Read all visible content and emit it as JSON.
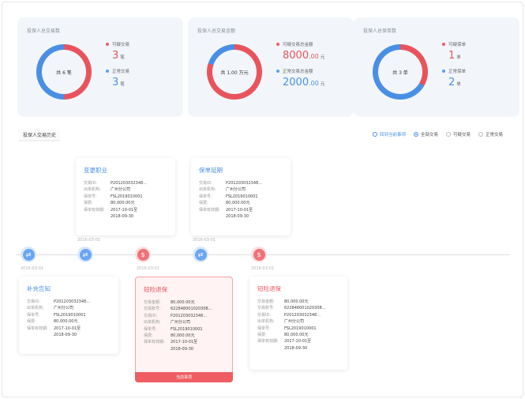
{
  "cards": [
    {
      "title": "投保人总交易数",
      "center": "共 6 笔",
      "legend": [
        {
          "label": "可疑交易",
          "value": "3",
          "unit": "笔",
          "color": "#e9545c"
        },
        {
          "label": "正常交易",
          "value": "3",
          "unit": "笔",
          "color": "#4a8fe6"
        }
      ],
      "suspicious_fraction": 0.5
    },
    {
      "title": "投保人总交易金额",
      "center": "共 1.00 万元",
      "legend": [
        {
          "label": "可疑交易总金额",
          "value": "8000",
          "decimal": ".00",
          "unit": "元",
          "color": "#e9545c"
        },
        {
          "label": "正常交易总金额",
          "value": "2000",
          "decimal": ".00",
          "unit": "元",
          "color": "#4a8fe6"
        }
      ],
      "suspicious_fraction": 0.8
    },
    {
      "title": "投保人总保单数",
      "center": "共 3 单",
      "legend": [
        {
          "label": "可疑保单",
          "value": "1",
          "unit": "单",
          "color": "#e9545c"
        },
        {
          "label": "正常保单",
          "value": "2",
          "unit": "单",
          "color": "#4a8fe6"
        }
      ],
      "suspicious_fraction": 0.333
    }
  ],
  "history": {
    "title": "投保人交易历史",
    "filters": [
      {
        "label": "回到当前事项",
        "state": "link"
      },
      {
        "label": "全部交易",
        "state": "checked"
      },
      {
        "label": "可疑交易",
        "state": "unchecked"
      },
      {
        "label": "正常交易",
        "state": "unchecked"
      }
    ]
  },
  "timeline": {
    "dates": [
      "2016-03-01",
      "2016-03-01",
      "2016-03-01",
      "2016-03-01",
      "2016-03-01"
    ],
    "nodes": [
      {
        "type": "blue",
        "icon": "transfer-icon"
      },
      {
        "type": "blue",
        "icon": "transfer-icon"
      },
      {
        "type": "red",
        "icon": "money-icon"
      },
      {
        "type": "blue",
        "icon": "transfer-icon"
      },
      {
        "type": "red",
        "icon": "money-icon"
      }
    ]
  },
  "events": {
    "top1": {
      "title": "变更职业",
      "rows": [
        {
          "k": "交易ID:",
          "v": "P201203032348..."
        },
        {
          "k": "出单机构:",
          "v": "广州分公司"
        },
        {
          "k": "保单号:",
          "v": "FSL2019010001"
        },
        {
          "k": "保费:",
          "v": "80,000.00元"
        },
        {
          "k": "保单有效期:",
          "v": "2017-10-01至\n2018-09-30"
        }
      ]
    },
    "top2": {
      "title": "保单延期",
      "rows": [
        {
          "k": "交易ID:",
          "v": "P201203032348..."
        },
        {
          "k": "出单机构:",
          "v": "广州分公司"
        },
        {
          "k": "保单号:",
          "v": "FSL2019010001"
        },
        {
          "k": "保费:",
          "v": "80,000.00元"
        },
        {
          "k": "保单有效期:",
          "v": "2017-10-01至\n2018-09-30"
        }
      ]
    },
    "bottom1": {
      "title": "补充告知",
      "rows": [
        {
          "k": "交易ID:",
          "v": "P201203032348..."
        },
        {
          "k": "出单机构:",
          "v": "广州分公司"
        },
        {
          "k": "保单号:",
          "v": "FSL2019010001"
        },
        {
          "k": "保费:",
          "v": "80,000.00元"
        },
        {
          "k": "保单有效期:",
          "v": "2017-10-01至\n2018-09-30"
        }
      ]
    },
    "bottom2": {
      "title": "短险退保",
      "rows": [
        {
          "k": "交易金额:",
          "v": "80,000.00元"
        },
        {
          "k": "交易账号:",
          "v": "622848001020308..."
        },
        {
          "k": "交易ID:",
          "v": "P201203032348..."
        },
        {
          "k": "出单机构:",
          "v": "广州分公司"
        },
        {
          "k": "保单号:",
          "v": "FSL2019010001"
        },
        {
          "k": "保费:",
          "v": "80,000.00元"
        },
        {
          "k": "保单有效期:",
          "v": "2017-10-01至\n2018-09-30"
        }
      ],
      "button": "当前事项"
    },
    "bottom3": {
      "title": "短险退保",
      "rows": [
        {
          "k": "交易金额:",
          "v": "80,000.00元"
        },
        {
          "k": "交易账号:",
          "v": "622848001020308..."
        },
        {
          "k": "交易ID:",
          "v": "P201203032348..."
        },
        {
          "k": "出单机构:",
          "v": "广州分公司"
        },
        {
          "k": "保单号:",
          "v": "FSL2019010001"
        },
        {
          "k": "保费:",
          "v": "80,000.00元"
        },
        {
          "k": "保单有效期:",
          "v": "2017-10-01至\n2018-09-30"
        }
      ]
    }
  }
}
